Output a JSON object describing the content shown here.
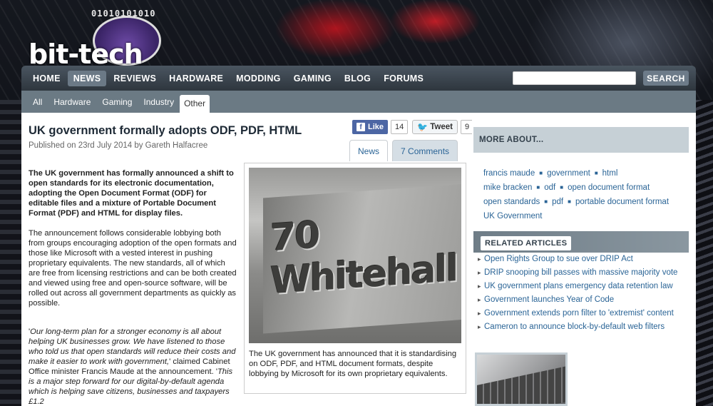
{
  "site": {
    "logo_text": "bit-tech",
    "logo_binary": "01010101010"
  },
  "nav": {
    "items": [
      {
        "label": "HOME"
      },
      {
        "label": "NEWS",
        "active": true
      },
      {
        "label": "REVIEWS"
      },
      {
        "label": "HARDWARE"
      },
      {
        "label": "MODDING"
      },
      {
        "label": "GAMING"
      },
      {
        "label": "BLOG"
      },
      {
        "label": "FORUMS"
      }
    ],
    "search_value": "",
    "search_button": "SEARCH"
  },
  "subnav": {
    "items": [
      {
        "label": "All"
      },
      {
        "label": "Hardware"
      },
      {
        "label": "Gaming"
      },
      {
        "label": "Industry"
      },
      {
        "label": "Other",
        "active": true
      }
    ]
  },
  "article": {
    "title": "UK government formally adopts ODF, PDF, HTML",
    "meta": "Published on 23rd July 2014 by Gareth Halfacree",
    "social": {
      "like_label": "Like",
      "like_count": "14",
      "tweet_label": "Tweet",
      "tweet_count": "9"
    },
    "tabs": [
      {
        "label": "News"
      },
      {
        "label": "7 Comments"
      }
    ],
    "lead": "The UK government has formally announced a shift to open standards for its electronic documentation, adopting the Open Document Format (ODF) for editable files and a mixture of Portable Document Format (PDF) and HTML for display files.",
    "paragraph": "The announcement follows considerable lobbying both from groups encouraging adoption of the open formats and those like Microsoft with a vested interest in pushing proprietary equivalents. The new standards, all of which are free from licensing restrictions and can be both created and viewed using free and open-source software, will be rolled out across all government departments as quickly as possible.",
    "quote_open": "'",
    "quote_part1": "Our long-term plan for a stronger economy is all about helping UK businesses grow. We have listened to those who told us that open standards will reduce their costs and make it easier to work with government,",
    "quote_attrib": "' claimed Cabinet Office minister Francis Maude at the announcement. '",
    "quote_part2": "This is a major step forward for our digital-by-default agenda which is helping save citizens, businesses and taxpayers £1.2",
    "figure": {
      "engraving": "70 Whitehall",
      "caption": "The UK government has announced that it is standardising on ODF, PDF, and HTML document formats, despite lobbying by Microsoft for its own proprietary equivalents."
    }
  },
  "sidebar": {
    "more_about_title": "MORE ABOUT...",
    "tags": [
      "francis maude",
      "government",
      "html",
      "mike bracken",
      "odf",
      "open document format",
      "open standards",
      "pdf",
      "portable document format",
      "UK Government"
    ],
    "related_title": "RELATED ARTICLES",
    "related": [
      "Open Rights Group to sue over DRIP Act",
      "DRIP snooping bill passes with massive majority vote",
      "UK government plans emergency data retention law",
      "Government launches Year of Code",
      "Government extends porn filter to 'extremist' content",
      "Cameron to announce block-by-default web filters"
    ]
  }
}
